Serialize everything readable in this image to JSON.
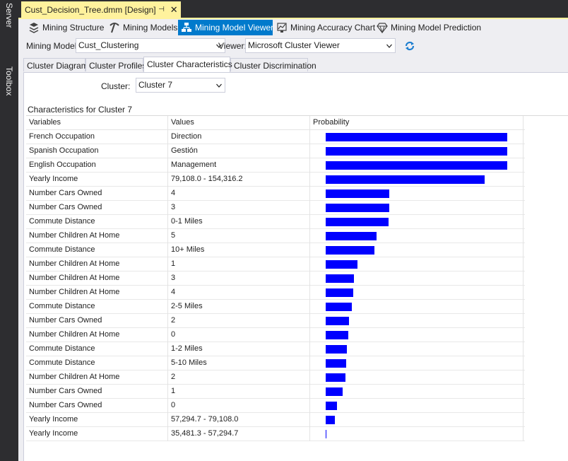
{
  "side_tabs": [
    "Server Explorer",
    "Toolbox"
  ],
  "document_tab": {
    "title": "Cust_Decision_Tree.dmm [Design]",
    "pin": "⊣",
    "close": "✕"
  },
  "toolbar": {
    "items": [
      {
        "label": "Mining Structure",
        "icon": "mining-structure-icon",
        "active": false
      },
      {
        "label": "Mining Models",
        "icon": "pickaxe-icon",
        "active": false
      },
      {
        "label": "Mining Model Viewer",
        "icon": "model-viewer-icon",
        "active": true
      },
      {
        "label": "Mining Accuracy Chart",
        "icon": "accuracy-chart-icon",
        "active": false
      },
      {
        "label": "Mining Model Prediction",
        "icon": "diamond-icon",
        "active": false
      }
    ]
  },
  "model_row": {
    "mining_model_label": "Mining Model:",
    "mining_model_value": "Cust_Clustering",
    "viewer_label": "Viewer:",
    "viewer_value": "Microsoft Cluster Viewer",
    "refresh_icon": "refresh-icon"
  },
  "sub_tabs": [
    {
      "label": "Cluster Diagram",
      "active": false
    },
    {
      "label": "Cluster Profiles",
      "active": false
    },
    {
      "label": "Cluster Characteristics",
      "active": true
    },
    {
      "label": "Cluster Discrimination",
      "active": false
    }
  ],
  "cluster": {
    "label": "Cluster:",
    "value": "Cluster 7"
  },
  "characteristics_title": "Characteristics for Cluster 7",
  "grid": {
    "headers": [
      "Variables",
      "Values",
      "Probability"
    ],
    "bar_color": "#0000ff",
    "rows": [
      {
        "variable": "French Occupation",
        "value": "Direction",
        "probability": 0.95
      },
      {
        "variable": "Spanish Occupation",
        "value": "Gestión",
        "probability": 0.95
      },
      {
        "variable": "English Occupation",
        "value": "Management",
        "probability": 0.95
      },
      {
        "variable": "Yearly Income",
        "value": "79,108.0 - 154,316.2",
        "probability": 0.835
      },
      {
        "variable": "Number Cars Owned",
        "value": "4",
        "probability": 0.335
      },
      {
        "variable": "Number Cars Owned",
        "value": "3",
        "probability": 0.335
      },
      {
        "variable": "Commute Distance",
        "value": "0-1 Miles",
        "probability": 0.33
      },
      {
        "variable": "Number Children At Home",
        "value": "5",
        "probability": 0.265
      },
      {
        "variable": "Commute Distance",
        "value": "10+ Miles",
        "probability": 0.255
      },
      {
        "variable": "Number Children At Home",
        "value": "1",
        "probability": 0.165
      },
      {
        "variable": "Number Children At Home",
        "value": "3",
        "probability": 0.148
      },
      {
        "variable": "Number Children At Home",
        "value": "4",
        "probability": 0.145
      },
      {
        "variable": "Commute Distance",
        "value": "2-5 Miles",
        "probability": 0.137
      },
      {
        "variable": "Number Cars Owned",
        "value": "2",
        "probability": 0.122
      },
      {
        "variable": "Number Children At Home",
        "value": "0",
        "probability": 0.119
      },
      {
        "variable": "Commute Distance",
        "value": "1-2 Miles",
        "probability": 0.111
      },
      {
        "variable": "Commute Distance",
        "value": "5-10 Miles",
        "probability": 0.107
      },
      {
        "variable": "Number Children At Home",
        "value": "2",
        "probability": 0.104
      },
      {
        "variable": "Number Cars Owned",
        "value": "1",
        "probability": 0.089
      },
      {
        "variable": "Number Cars Owned",
        "value": "0",
        "probability": 0.059
      },
      {
        "variable": "Yearly Income",
        "value": "57,294.7 - 79,108.0",
        "probability": 0.048
      },
      {
        "variable": "Yearly Income",
        "value": "35,481.3 - 57,294.7",
        "probability": 0.004
      }
    ]
  }
}
